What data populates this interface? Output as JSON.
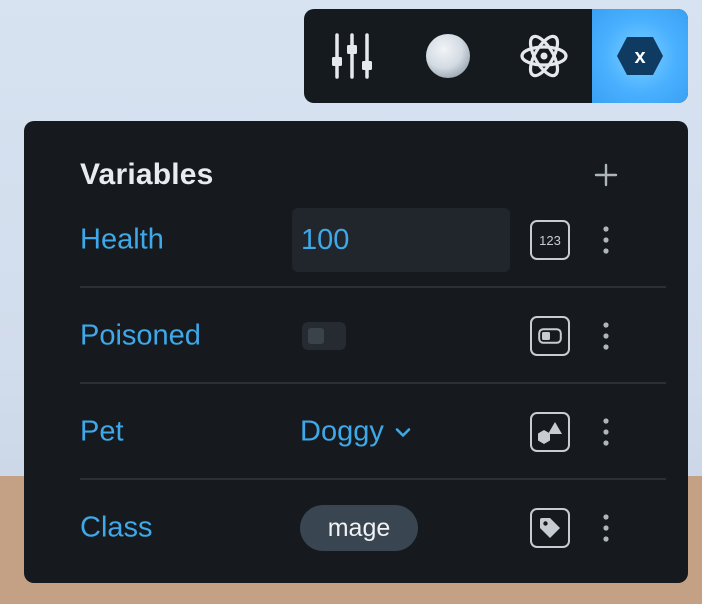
{
  "toolbar": {
    "buttons": [
      {
        "icon": "sliders-icon",
        "active": false
      },
      {
        "icon": "sphere-icon",
        "active": false
      },
      {
        "icon": "atom-icon",
        "active": false
      },
      {
        "icon": "variable-x-icon",
        "label": "x",
        "active": true
      }
    ],
    "accent": "#49b0ff"
  },
  "panel": {
    "title": "Variables",
    "add_icon": "plus-icon",
    "variables": [
      {
        "name": "Health",
        "kind": "number",
        "value": "100",
        "type_icon": "number-type-icon",
        "type_label": "123"
      },
      {
        "name": "Poisoned",
        "kind": "boolean",
        "value": false,
        "type_icon": "boolean-type-icon"
      },
      {
        "name": "Pet",
        "kind": "enum",
        "value": "Doggy",
        "type_icon": "enum-type-icon"
      },
      {
        "name": "Class",
        "kind": "tag",
        "value": "mage",
        "type_icon": "tag-type-icon"
      }
    ],
    "more_icon": "more-vertical-icon",
    "name_color": "#3ea8e8"
  }
}
